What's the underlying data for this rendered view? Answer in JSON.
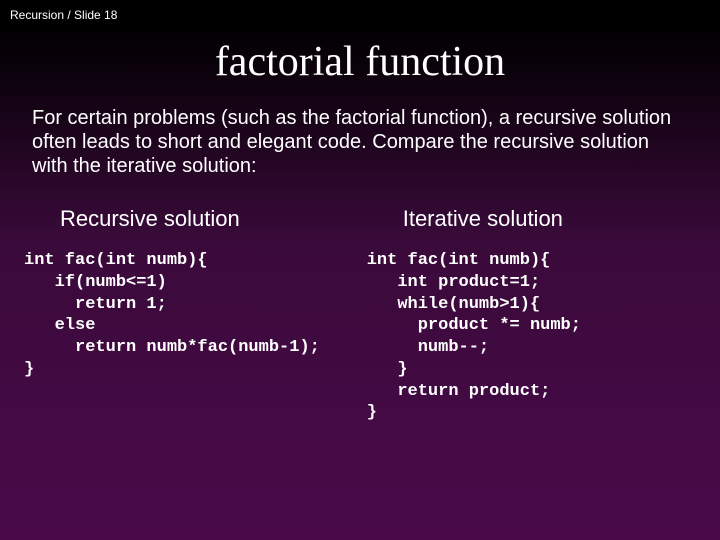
{
  "header": "Recursion / Slide 18",
  "title": "factorial function",
  "intro": "For certain problems (such as the factorial function), a recursive solution often leads to short and elegant code. Compare the recursive solution with the iterative solution:",
  "left": {
    "heading": "Recursive solution",
    "code": "int fac(int numb){\n   if(numb<=1)\n     return 1;\n   else\n     return numb*fac(numb-1);\n}"
  },
  "right": {
    "heading": "Iterative solution",
    "code": "int fac(int numb){\n   int product=1;\n   while(numb>1){\n     product *= numb;\n     numb--;\n   }\n   return product;\n}"
  }
}
